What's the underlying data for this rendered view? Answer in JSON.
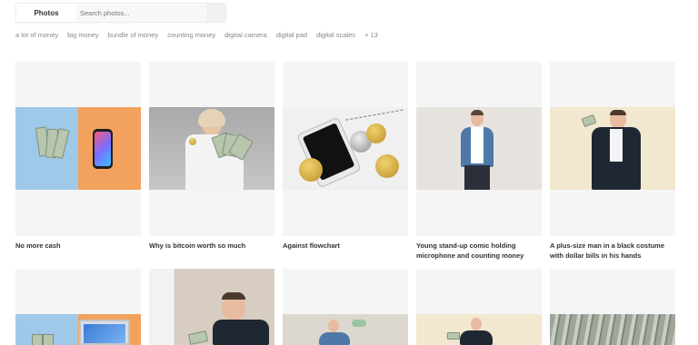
{
  "search": {
    "scope_label": "Photos",
    "placeholder": "Search photos..."
  },
  "tags": [
    "a lot of money",
    "big money",
    "bundle of money",
    "counting money",
    "digital camera",
    "digital pad",
    "digital scales",
    "+ 13"
  ],
  "photos_row1": [
    {
      "caption": "No more cash"
    },
    {
      "caption": "Why is bitcoin worth so much"
    },
    {
      "caption": "Against flowchart"
    },
    {
      "caption": "Young stand-up comic holding",
      "caption2": "microphone and counting money"
    },
    {
      "caption": "A plus-size man in a black costume",
      "caption2": "with dollar bills in his hands"
    }
  ],
  "icons": {
    "search": "search-icon"
  },
  "colors": {
    "tile_bg": "#f5f5f5",
    "caption": "#333333",
    "tag": "#888888"
  }
}
